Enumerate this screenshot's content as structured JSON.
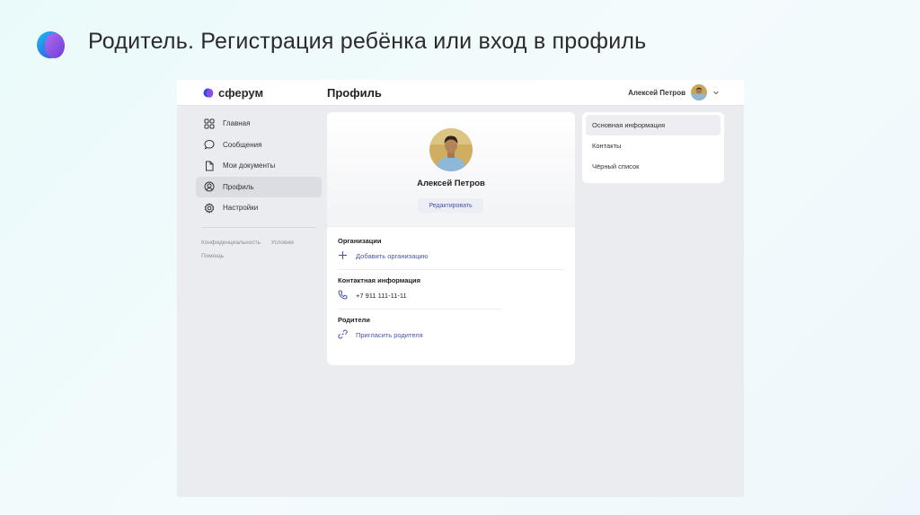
{
  "slide": {
    "title": "Родитель. Регистрация ребёнка или вход в профиль"
  },
  "app": {
    "brand": "сферум",
    "page_title": "Профиль",
    "user_name": "Алексей Петров",
    "sidebar": {
      "items": [
        {
          "label": "Главная",
          "icon": "home-grid-icon"
        },
        {
          "label": "Сообщения",
          "icon": "chat-bubble-icon"
        },
        {
          "label": "Мои документы",
          "icon": "document-icon"
        },
        {
          "label": "Профиль",
          "icon": "profile-icon",
          "active": true
        },
        {
          "label": "Настройки",
          "icon": "gear-icon"
        }
      ],
      "footer_links": [
        "Конфиденциальность",
        "Условия",
        "Помощь"
      ]
    },
    "profile": {
      "name": "Алексей Петров",
      "edit_label": "Редактировать",
      "organizations_title": "Организации",
      "add_org_label": "Добавить организацию",
      "contact_title": "Контактная информация",
      "phone": "+7 911 111-11-11",
      "parents_title": "Родители",
      "invite_parent_label": "Пригласить родителя"
    },
    "info_menu": {
      "items": [
        "Основная информация",
        "Контакты",
        "Чёрный список"
      ]
    }
  },
  "colors": {
    "accent": "#4a54a8",
    "background": "#ebecef",
    "card": "#ffffff",
    "active_nav": "#dcdde3"
  }
}
